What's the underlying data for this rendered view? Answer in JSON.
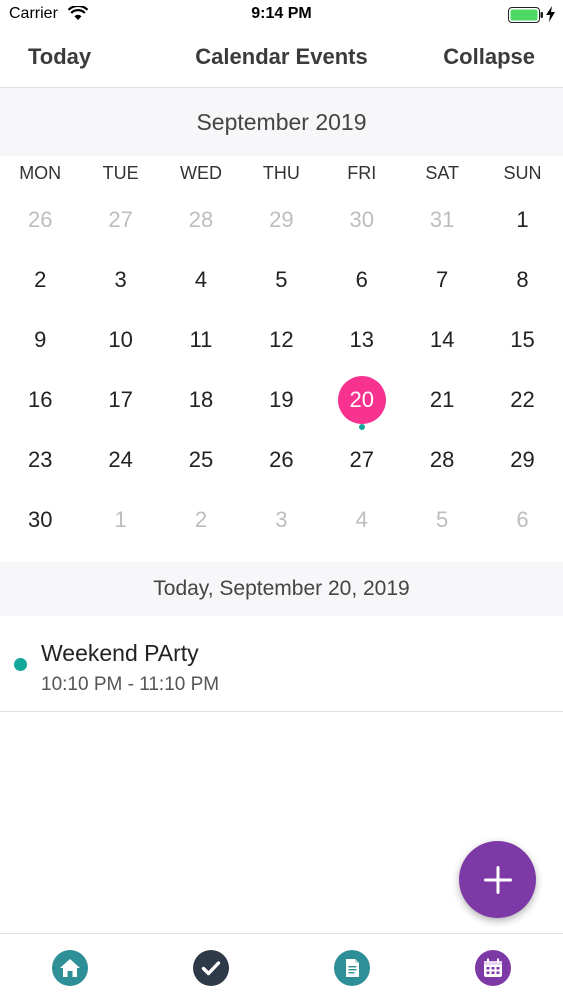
{
  "status_bar": {
    "carrier": "Carrier",
    "time": "9:14 PM"
  },
  "nav": {
    "today_label": "Today",
    "title": "Calendar Events",
    "collapse_label": "Collapse"
  },
  "calendar": {
    "month_label": "September 2019",
    "weekdays": [
      "MON",
      "TUE",
      "WED",
      "THU",
      "FRI",
      "SAT",
      "SUN"
    ],
    "weeks": [
      [
        "26",
        "27",
        "28",
        "29",
        "30",
        "31",
        "1"
      ],
      [
        "2",
        "3",
        "4",
        "5",
        "6",
        "7",
        "8"
      ],
      [
        "9",
        "10",
        "11",
        "12",
        "13",
        "14",
        "15"
      ],
      [
        "16",
        "17",
        "18",
        "19",
        "20",
        "21",
        "22"
      ],
      [
        "23",
        "24",
        "25",
        "26",
        "27",
        "28",
        "29"
      ],
      [
        "30",
        "1",
        "2",
        "3",
        "4",
        "5",
        "6"
      ]
    ],
    "selected_day": "20"
  },
  "selected_date_label": "Today, September 20, 2019",
  "events": [
    {
      "title": "Weekend PArty",
      "time": "10:10 PM - 11:10 PM",
      "color": "#14a89a"
    }
  ],
  "colors": {
    "selected": "#f7338f",
    "event_dot": "#14a89a",
    "fab": "#7d39a6",
    "tab_home": "#2f8f97",
    "tab_tasks": "#2e3a47",
    "tab_notes": "#2f8f97",
    "tab_calendar": "#7d39a6"
  },
  "icons": {
    "wifi": "wifi-icon",
    "battery": "battery-icon",
    "charging": "bolt-icon",
    "fab": "plus-icon",
    "tab_home": "home-icon",
    "tab_tasks": "checkmark-icon",
    "tab_notes": "document-icon",
    "tab_calendar": "calendar-icon"
  }
}
